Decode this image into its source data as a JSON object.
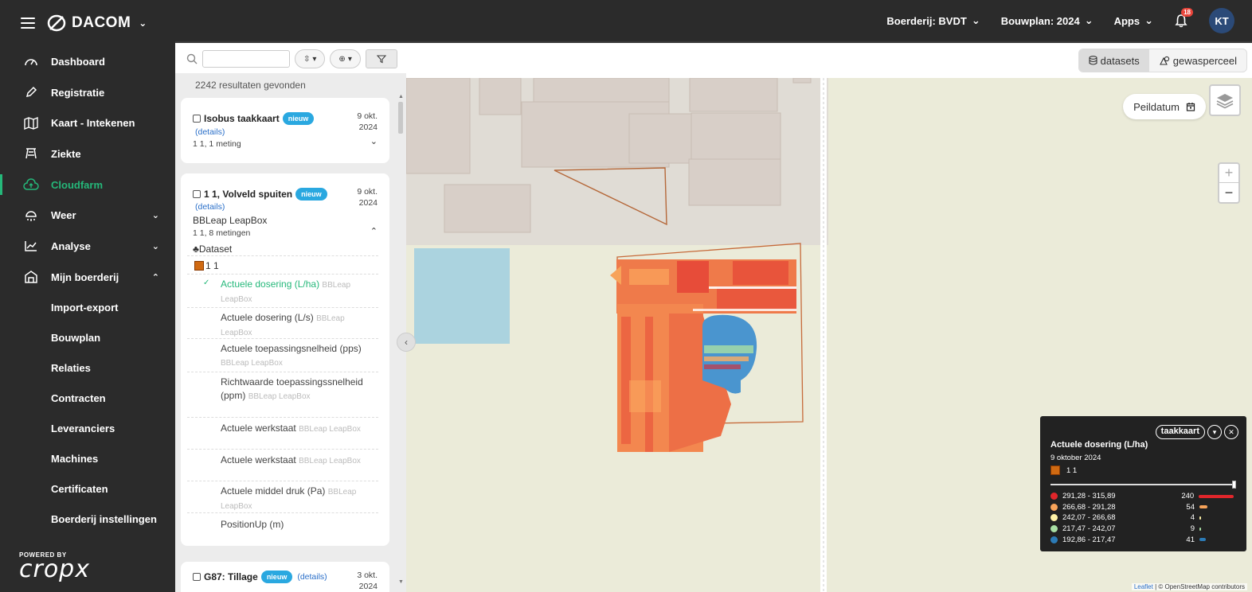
{
  "brand": {
    "name": "DACOM"
  },
  "sidebar": {
    "items": [
      {
        "label": "Dashboard",
        "icon": "gauge-icon"
      },
      {
        "label": "Registratie",
        "icon": "pencil-icon"
      },
      {
        "label": "Kaart - Intekenen",
        "icon": "map-icon"
      },
      {
        "label": "Ziekte",
        "icon": "pest-icon"
      },
      {
        "label": "Cloudfarm",
        "icon": "cloud-upload-icon"
      },
      {
        "label": "Weer",
        "icon": "weather-icon"
      },
      {
        "label": "Analyse",
        "icon": "chart-icon"
      },
      {
        "label": "Mijn boerderij",
        "icon": "farm-icon"
      }
    ],
    "sub_items": [
      "Import-export",
      "Bouwplan",
      "Relaties",
      "Contracten",
      "Leveranciers",
      "Machines",
      "Certificaten",
      "Boerderij instellingen"
    ],
    "powered_by": "POWERED BY",
    "powered_logo": "cropx"
  },
  "topbar": {
    "farm": "Boerderij: BVDT",
    "bouwplan": "Bouwplan: 2024",
    "apps": "Apps",
    "notifications": "18",
    "avatar": "KT"
  },
  "panel": {
    "results": "2242 resultaten gevonden",
    "cards": [
      {
        "title": "Isobus taakkaart",
        "badge": "nieuw",
        "details": "(details)",
        "date": "9 okt.",
        "year": "2024",
        "meta": "1 1, 1 meting"
      },
      {
        "title": "1 1, Volveld spuiten",
        "badge": "nieuw",
        "details": "(details)",
        "date": "9 okt.",
        "year": "2024",
        "device": "BBLeap LeapBox",
        "meta": "1 1, 8 metingen",
        "dataset_label": "Dataset",
        "field": "1 1",
        "datasets": [
          {
            "name": "Actuele dosering (L/ha)",
            "src": "BBLeap LeapBox"
          },
          {
            "name": "Actuele dosering (L/s)",
            "src": "BBLeap LeapBox"
          },
          {
            "name": "Actuele toepassingsnelheid (pps)",
            "src": "BBLeap LeapBox"
          },
          {
            "name": "Richtwaarde toepassingssnelheid (ppm)",
            "src": "BBLeap LeapBox"
          },
          {
            "name": "Actuele werkstaat",
            "src": "BBLeap LeapBox"
          },
          {
            "name": "Actuele werkstaat",
            "src": "BBLeap LeapBox"
          },
          {
            "name": "Actuele middel druk (Pa)",
            "src": "BBLeap LeapBox"
          },
          {
            "name": "PositionUp (m)",
            "src": ""
          }
        ]
      },
      {
        "title": "G87: Tillage",
        "badge": "nieuw",
        "details": "(details)",
        "date": "3 okt.",
        "year": "2024"
      }
    ]
  },
  "map": {
    "toggle_datasets": "datasets",
    "toggle_gewasperceel": "gewasperceel",
    "peildatum": "Peildatum",
    "zoom_in": "+",
    "zoom_out": "−",
    "attribution_leaflet": "Leaflet",
    "attribution_rest": " | © OpenStreetMap contributors"
  },
  "legend": {
    "mode": "taakkaart",
    "title": "Actuele dosering (L/ha)",
    "date": "9 oktober 2024",
    "field": "1 1",
    "classes": [
      {
        "range": "291,28 - 315,89",
        "count": 240,
        "color": "#e0262b"
      },
      {
        "range": "266,68 - 291,28",
        "count": 54,
        "color": "#f7a35a"
      },
      {
        "range": "242,07 - 266,68",
        "count": 4,
        "color": "#fff3a8"
      },
      {
        "range": "217,47 - 242,07",
        "count": 9,
        "color": "#a9dfa4"
      },
      {
        "range": "192,86 - 217,47",
        "count": 41,
        "color": "#2c7bb6"
      }
    ]
  },
  "colors": {
    "accent": "#25b87a",
    "sidebar_bg": "#2b2b2b",
    "badge": "#2aa8e0"
  }
}
